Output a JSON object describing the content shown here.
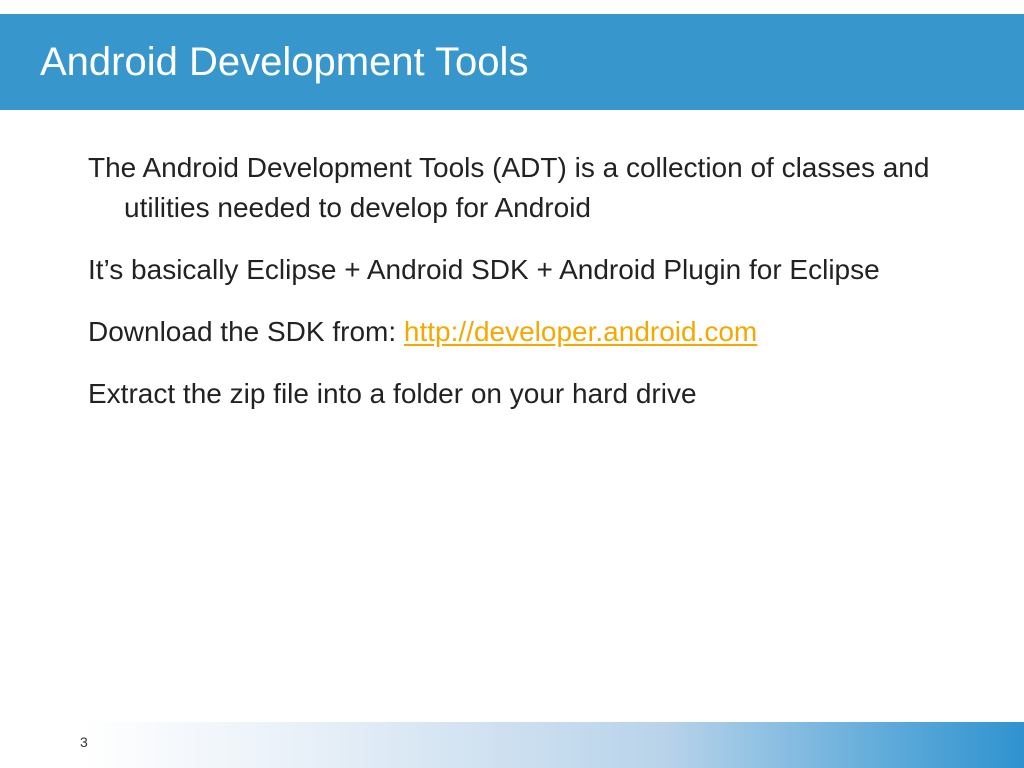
{
  "slide": {
    "title": "Android Development Tools",
    "bullets": {
      "b1": "The Android Development Tools (ADT) is a collection of classes and utilities needed to develop for Android",
      "b2": "It’s basically Eclipse + Android SDK + Android Plugin for Eclipse",
      "b3_prefix": "Download the SDK from: ",
      "b3_link": "http://developer.android.com",
      "b4": "Extract the zip file into a folder on your hard drive"
    },
    "page_number": "3"
  },
  "colors": {
    "title_bar": "#3797cd",
    "title_text": "#ffffff",
    "body_text": "#222222",
    "link": "#f5a800",
    "footer_gradient_end": "#2f93cf"
  }
}
